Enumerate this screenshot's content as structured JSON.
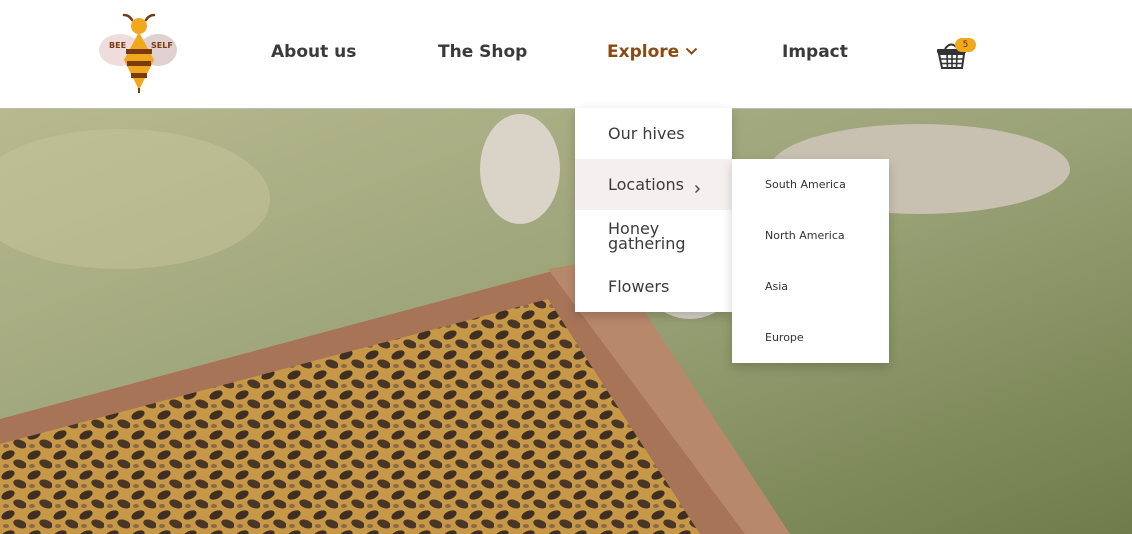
{
  "logo": {
    "left_text": "BEE",
    "right_text": "SELF",
    "icon": "bee-logo-icon"
  },
  "nav": {
    "about": "About us",
    "shop": "The Shop",
    "explore": "Explore",
    "impact": "Impact"
  },
  "cart": {
    "icon": "basket-icon",
    "count": "5"
  },
  "explore_menu": {
    "items": [
      {
        "label": "Our hives"
      },
      {
        "label": "Locations"
      },
      {
        "label": "Honey",
        "label2": "gathering"
      },
      {
        "label": "Flowers"
      }
    ]
  },
  "locations_menu": {
    "items": [
      {
        "label": "South America"
      },
      {
        "label": "North America"
      },
      {
        "label": "Asia"
      },
      {
        "label": "Europe"
      }
    ]
  },
  "colors": {
    "accent": "#8c4a12",
    "badge": "#f2a81d",
    "nav_text": "#3a3a3a"
  }
}
